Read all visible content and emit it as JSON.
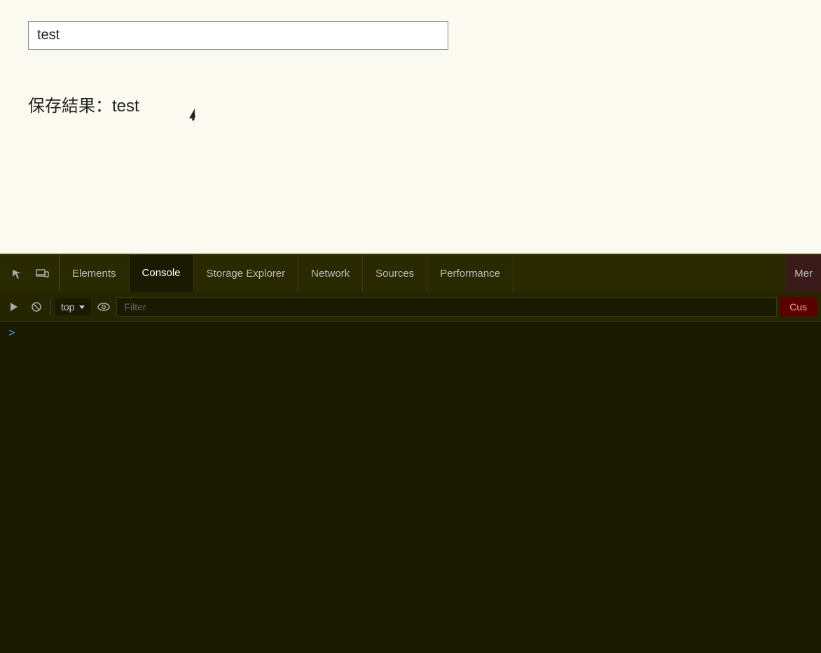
{
  "page": {
    "input_value": "test",
    "saved_result_label": "保存結果：test"
  },
  "devtools": {
    "tabs": [
      {
        "id": "elements",
        "label": "Elements",
        "active": false
      },
      {
        "id": "console",
        "label": "Console",
        "active": true
      },
      {
        "id": "storage-explorer",
        "label": "Storage Explorer",
        "active": false
      },
      {
        "id": "network",
        "label": "Network",
        "active": false
      },
      {
        "id": "sources",
        "label": "Sources",
        "active": false
      },
      {
        "id": "performance",
        "label": "Performance",
        "active": false
      },
      {
        "id": "more",
        "label": "Mer",
        "active": false
      }
    ],
    "toolbar": {
      "context_label": "top",
      "filter_placeholder": "Filter",
      "cus_label": "Cus"
    },
    "console_prompt": ">"
  }
}
